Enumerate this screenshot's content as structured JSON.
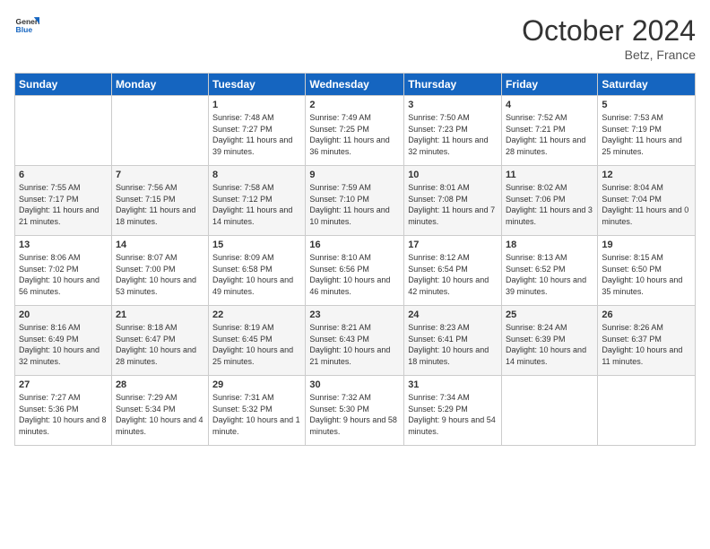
{
  "header": {
    "logo": {
      "line1": "General",
      "line2": "Blue"
    },
    "title": "October 2024",
    "location": "Betz, France"
  },
  "days_of_week": [
    "Sunday",
    "Monday",
    "Tuesday",
    "Wednesday",
    "Thursday",
    "Friday",
    "Saturday"
  ],
  "weeks": [
    [
      {
        "day": "",
        "sunrise": "",
        "sunset": "",
        "daylight": ""
      },
      {
        "day": "",
        "sunrise": "",
        "sunset": "",
        "daylight": ""
      },
      {
        "day": "1",
        "sunrise": "Sunrise: 7:48 AM",
        "sunset": "Sunset: 7:27 PM",
        "daylight": "Daylight: 11 hours and 39 minutes."
      },
      {
        "day": "2",
        "sunrise": "Sunrise: 7:49 AM",
        "sunset": "Sunset: 7:25 PM",
        "daylight": "Daylight: 11 hours and 36 minutes."
      },
      {
        "day": "3",
        "sunrise": "Sunrise: 7:50 AM",
        "sunset": "Sunset: 7:23 PM",
        "daylight": "Daylight: 11 hours and 32 minutes."
      },
      {
        "day": "4",
        "sunrise": "Sunrise: 7:52 AM",
        "sunset": "Sunset: 7:21 PM",
        "daylight": "Daylight: 11 hours and 28 minutes."
      },
      {
        "day": "5",
        "sunrise": "Sunrise: 7:53 AM",
        "sunset": "Sunset: 7:19 PM",
        "daylight": "Daylight: 11 hours and 25 minutes."
      }
    ],
    [
      {
        "day": "6",
        "sunrise": "Sunrise: 7:55 AM",
        "sunset": "Sunset: 7:17 PM",
        "daylight": "Daylight: 11 hours and 21 minutes."
      },
      {
        "day": "7",
        "sunrise": "Sunrise: 7:56 AM",
        "sunset": "Sunset: 7:15 PM",
        "daylight": "Daylight: 11 hours and 18 minutes."
      },
      {
        "day": "8",
        "sunrise": "Sunrise: 7:58 AM",
        "sunset": "Sunset: 7:12 PM",
        "daylight": "Daylight: 11 hours and 14 minutes."
      },
      {
        "day": "9",
        "sunrise": "Sunrise: 7:59 AM",
        "sunset": "Sunset: 7:10 PM",
        "daylight": "Daylight: 11 hours and 10 minutes."
      },
      {
        "day": "10",
        "sunrise": "Sunrise: 8:01 AM",
        "sunset": "Sunset: 7:08 PM",
        "daylight": "Daylight: 11 hours and 7 minutes."
      },
      {
        "day": "11",
        "sunrise": "Sunrise: 8:02 AM",
        "sunset": "Sunset: 7:06 PM",
        "daylight": "Daylight: 11 hours and 3 minutes."
      },
      {
        "day": "12",
        "sunrise": "Sunrise: 8:04 AM",
        "sunset": "Sunset: 7:04 PM",
        "daylight": "Daylight: 11 hours and 0 minutes."
      }
    ],
    [
      {
        "day": "13",
        "sunrise": "Sunrise: 8:06 AM",
        "sunset": "Sunset: 7:02 PM",
        "daylight": "Daylight: 10 hours and 56 minutes."
      },
      {
        "day": "14",
        "sunrise": "Sunrise: 8:07 AM",
        "sunset": "Sunset: 7:00 PM",
        "daylight": "Daylight: 10 hours and 53 minutes."
      },
      {
        "day": "15",
        "sunrise": "Sunrise: 8:09 AM",
        "sunset": "Sunset: 6:58 PM",
        "daylight": "Daylight: 10 hours and 49 minutes."
      },
      {
        "day": "16",
        "sunrise": "Sunrise: 8:10 AM",
        "sunset": "Sunset: 6:56 PM",
        "daylight": "Daylight: 10 hours and 46 minutes."
      },
      {
        "day": "17",
        "sunrise": "Sunrise: 8:12 AM",
        "sunset": "Sunset: 6:54 PM",
        "daylight": "Daylight: 10 hours and 42 minutes."
      },
      {
        "day": "18",
        "sunrise": "Sunrise: 8:13 AM",
        "sunset": "Sunset: 6:52 PM",
        "daylight": "Daylight: 10 hours and 39 minutes."
      },
      {
        "day": "19",
        "sunrise": "Sunrise: 8:15 AM",
        "sunset": "Sunset: 6:50 PM",
        "daylight": "Daylight: 10 hours and 35 minutes."
      }
    ],
    [
      {
        "day": "20",
        "sunrise": "Sunrise: 8:16 AM",
        "sunset": "Sunset: 6:49 PM",
        "daylight": "Daylight: 10 hours and 32 minutes."
      },
      {
        "day": "21",
        "sunrise": "Sunrise: 8:18 AM",
        "sunset": "Sunset: 6:47 PM",
        "daylight": "Daylight: 10 hours and 28 minutes."
      },
      {
        "day": "22",
        "sunrise": "Sunrise: 8:19 AM",
        "sunset": "Sunset: 6:45 PM",
        "daylight": "Daylight: 10 hours and 25 minutes."
      },
      {
        "day": "23",
        "sunrise": "Sunrise: 8:21 AM",
        "sunset": "Sunset: 6:43 PM",
        "daylight": "Daylight: 10 hours and 21 minutes."
      },
      {
        "day": "24",
        "sunrise": "Sunrise: 8:23 AM",
        "sunset": "Sunset: 6:41 PM",
        "daylight": "Daylight: 10 hours and 18 minutes."
      },
      {
        "day": "25",
        "sunrise": "Sunrise: 8:24 AM",
        "sunset": "Sunset: 6:39 PM",
        "daylight": "Daylight: 10 hours and 14 minutes."
      },
      {
        "day": "26",
        "sunrise": "Sunrise: 8:26 AM",
        "sunset": "Sunset: 6:37 PM",
        "daylight": "Daylight: 10 hours and 11 minutes."
      }
    ],
    [
      {
        "day": "27",
        "sunrise": "Sunrise: 7:27 AM",
        "sunset": "Sunset: 5:36 PM",
        "daylight": "Daylight: 10 hours and 8 minutes."
      },
      {
        "day": "28",
        "sunrise": "Sunrise: 7:29 AM",
        "sunset": "Sunset: 5:34 PM",
        "daylight": "Daylight: 10 hours and 4 minutes."
      },
      {
        "day": "29",
        "sunrise": "Sunrise: 7:31 AM",
        "sunset": "Sunset: 5:32 PM",
        "daylight": "Daylight: 10 hours and 1 minute."
      },
      {
        "day": "30",
        "sunrise": "Sunrise: 7:32 AM",
        "sunset": "Sunset: 5:30 PM",
        "daylight": "Daylight: 9 hours and 58 minutes."
      },
      {
        "day": "31",
        "sunrise": "Sunrise: 7:34 AM",
        "sunset": "Sunset: 5:29 PM",
        "daylight": "Daylight: 9 hours and 54 minutes."
      },
      {
        "day": "",
        "sunrise": "",
        "sunset": "",
        "daylight": ""
      },
      {
        "day": "",
        "sunrise": "",
        "sunset": "",
        "daylight": ""
      }
    ]
  ]
}
